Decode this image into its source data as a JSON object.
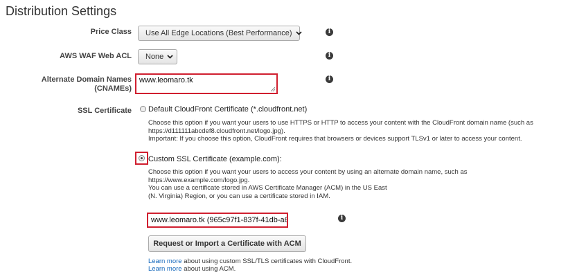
{
  "section_title": "Distribution Settings",
  "price_class": {
    "label": "Price Class",
    "value": "Use All Edge Locations (Best Performance)"
  },
  "waf": {
    "label": "AWS WAF Web ACL",
    "value": "None"
  },
  "cnames": {
    "label_line1": "Alternate Domain Names",
    "label_line2": "(CNAMEs)",
    "value": "www.leomaro.tk"
  },
  "ssl": {
    "label": "SSL Certificate",
    "default_option": "Default CloudFront Certificate (*.cloudfront.net)",
    "default_desc": [
      "Choose this option if you want your users to use HTTPS or HTTP to access your content with the CloudFront domain name (such as",
      "https://d111111abcdef8.cloudfront.net/logo.jpg).",
      "Important: If you choose this option, CloudFront requires that browsers or devices support TLSv1 or later to access your content."
    ],
    "custom_option": "Custom SSL Certificate (example.com):",
    "custom_desc": [
      "Choose this option if you want your users to access your content by using an alternate domain name, such as",
      "https://www.example.com/logo.jpg.",
      "You can use a certificate stored in AWS Certificate Manager (ACM) in the US East",
      "(N. Virginia) Region, or you can use a certificate stored in IAM."
    ],
    "certificate_value": "www.leomaro.tk (965c97f1-837f-41db-a6",
    "acm_button": "Request or Import a Certificate with ACM",
    "link1_text": "Learn more",
    "link1_rest": " about using custom SSL/TLS certificates with CloudFront.",
    "link2_text": "Learn more",
    "link2_rest": " about using ACM."
  },
  "icons": {
    "info": "i",
    "chevron": "❯"
  }
}
